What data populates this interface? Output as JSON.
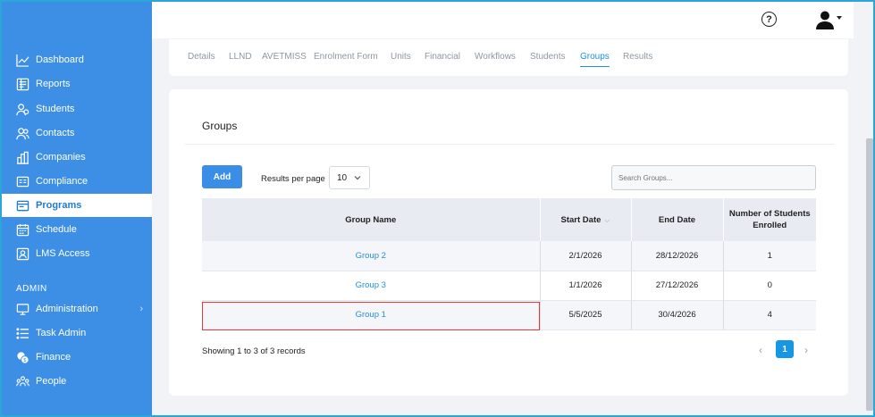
{
  "sidebar": {
    "items": [
      {
        "label": "Dashboard",
        "icon": "chart-line-icon"
      },
      {
        "label": "Reports",
        "icon": "report-icon"
      },
      {
        "label": "Students",
        "icon": "students-icon"
      },
      {
        "label": "Contacts",
        "icon": "contacts-icon"
      },
      {
        "label": "Companies",
        "icon": "companies-icon"
      },
      {
        "label": "Compliance",
        "icon": "compliance-icon"
      },
      {
        "label": "Programs",
        "icon": "programs-icon",
        "active": true
      },
      {
        "label": "Schedule",
        "icon": "schedule-icon"
      },
      {
        "label": "LMS Access",
        "icon": "lms-icon"
      }
    ],
    "section_label": "ADMIN",
    "admin_items": [
      {
        "label": "Administration",
        "icon": "administration-icon",
        "has_submenu": true
      },
      {
        "label": "Task Admin",
        "icon": "task-list-icon"
      },
      {
        "label": "Finance",
        "icon": "finance-icon"
      },
      {
        "label": "People",
        "icon": "people-icon"
      }
    ],
    "bg_color": "#3d8fe6"
  },
  "header": {
    "help_label": "?"
  },
  "tabs": [
    {
      "label": "Details"
    },
    {
      "label": "LLND"
    },
    {
      "label": "AVETMISS"
    },
    {
      "label": "Enrolment Form"
    },
    {
      "label": "Units"
    },
    {
      "label": "Financial"
    },
    {
      "label": "Workflows"
    },
    {
      "label": "Students"
    },
    {
      "label": "Groups",
      "active": true
    },
    {
      "label": "Results"
    }
  ],
  "groups": {
    "title": "Groups",
    "add_label": "Add",
    "results_per_page_label": "Results per page",
    "results_per_page_value": "10",
    "search_placeholder": "Search Groups...",
    "columns": {
      "name": "Group Name",
      "start": "Start Date",
      "end": "End Date",
      "enrolled_line1": "Number of Students",
      "enrolled_line2": "Enrolled"
    },
    "rows": [
      {
        "name": "Group 2",
        "start": "2/1/2026",
        "end": "28/12/2026",
        "enrolled": "1"
      },
      {
        "name": "Group 3",
        "start": "1/1/2026",
        "end": "27/12/2026",
        "enrolled": "0"
      },
      {
        "name": "Group 1",
        "start": "5/5/2025",
        "end": "30/4/2026",
        "enrolled": "4"
      }
    ],
    "records_info": "Showing 1 to 3 of 3 records",
    "pagination": {
      "prev": "‹",
      "current": "1",
      "next": "›"
    }
  },
  "colors": {
    "accent": "#1f8fe0",
    "button": "#3a8ee8",
    "highlight": "#e03a3a"
  }
}
